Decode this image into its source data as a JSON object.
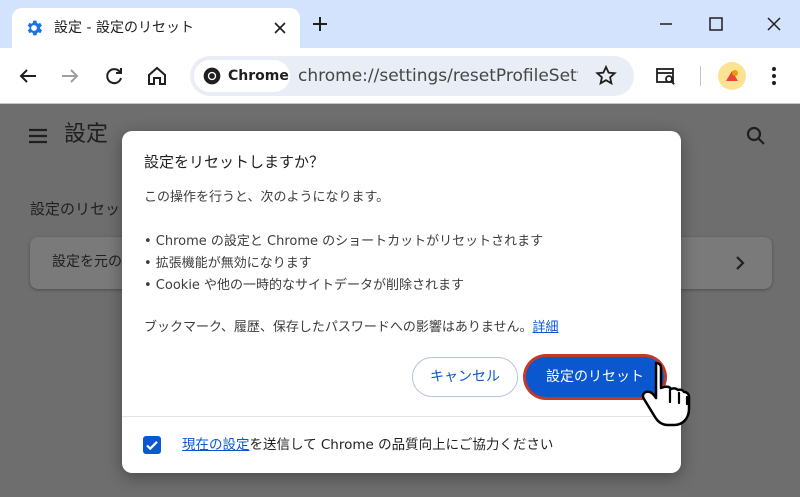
{
  "tab": {
    "title": "設定 - 設定のリセット"
  },
  "omnibox": {
    "chip_label": "Chrome",
    "url": "chrome://settings/resetProfileSettin..."
  },
  "page": {
    "title": "設定",
    "section_title": "設定のリセッ",
    "card_label": "設定を元の"
  },
  "dialog": {
    "title": "設定をリセットしますか？",
    "intro": "この操作を行うと、次のようになります。",
    "items": [
      "• Chrome の設定と Chrome のショートカットがリセットされます",
      "• 拡張機能が無効になります",
      "• Cookie や他の一時的なサイトデータが削除されます"
    ],
    "note": "ブックマーク、履歴、保存したパスワードへの影響はありません。",
    "note_link": "詳細",
    "cancel_label": "キャンセル",
    "reset_label": "設定のリセット",
    "footer_link": "現在の設定",
    "footer_text": "を送信して Chrome の品質向上にご協力ください",
    "checkbox_checked": true
  },
  "colors": {
    "accent": "#0b57d0",
    "highlight": "#c0392b",
    "titlebar": "#d3e3fd"
  }
}
